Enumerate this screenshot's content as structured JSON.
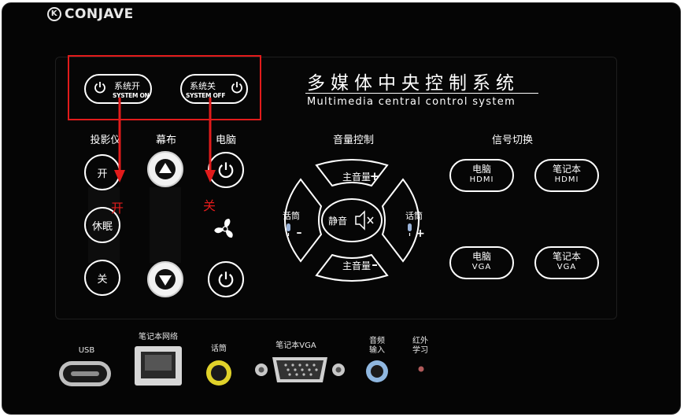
{
  "brand": "CONJAVE",
  "brand_mark": "K",
  "title_cn": "多媒体中央控制系统",
  "title_en": "Multimedia central control system",
  "system": {
    "on_cn": "系统开",
    "on_en": "SYSTEM ON",
    "off_cn": "系统关",
    "off_en": "SYSTEM OFF"
  },
  "projector": {
    "heading": "投影仪",
    "on": "开",
    "sleep": "休眠",
    "off": "关"
  },
  "screen": {
    "heading": "幕布"
  },
  "computer": {
    "heading": "电脑"
  },
  "volume": {
    "heading": "音量控制",
    "master_up": "主音量",
    "master_down": "主音量",
    "mic_left": "话筒",
    "mic_right": "话筒",
    "mute": "静音"
  },
  "signal": {
    "heading": "信号切换",
    "buttons": [
      {
        "a": "电脑",
        "b": "HDMI"
      },
      {
        "a": "笔记本",
        "b": "HDMI"
      },
      {
        "a": "电脑",
        "b": "VGA"
      },
      {
        "a": "笔记本",
        "b": "VGA"
      }
    ]
  },
  "annotations": {
    "left": "开",
    "right": "关"
  },
  "ports": {
    "usb": "USB",
    "network": "笔记本网络",
    "mic": "话筒",
    "vga": "笔记本VGA",
    "audio_in_1": "音频",
    "audio_in_2": "输入",
    "ir_1": "红外",
    "ir_2": "学习"
  },
  "colors": {
    "annotation_red": "#e21b1b",
    "panel": "#050505",
    "audio_port_blue": "#8fb7e0",
    "mic_port_yellow": "#e0d22a"
  },
  "icons": [
    "power-icon",
    "arrow-up-icon",
    "arrow-down-icon",
    "fan-icon",
    "speaker-mute-icon",
    "microphone-icon"
  ]
}
